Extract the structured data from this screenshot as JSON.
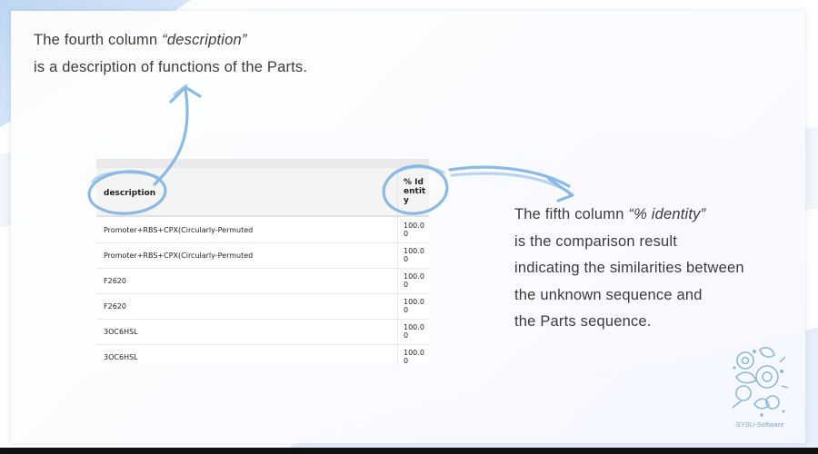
{
  "captions": {
    "top_line1_prefix": "The fourth column ",
    "top_line1_term": "“description”",
    "top_line2": "is a description of functions of the Parts.",
    "right_line1_prefix": "The fifth column ",
    "right_line1_term": "“% identity”",
    "right_line2": "is the comparison result",
    "right_line3": "indicating the similarities between",
    "right_line4": "the unknown sequence and",
    "right_line5": "the Parts sequence."
  },
  "table": {
    "headers": {
      "description": "description",
      "identity": "% Identity"
    },
    "rows": [
      {
        "description": "Promoter+RBS+CPX(Circularly-Permuted",
        "identity": "100.00"
      },
      {
        "description": "Promoter+RBS+CPX(Circularly-Permuted",
        "identity": "100.00"
      },
      {
        "description": "F2620",
        "identity": "100.00"
      },
      {
        "description": "F2620",
        "identity": "100.00"
      },
      {
        "description": "3OC6HSL",
        "identity": "100.00"
      },
      {
        "description": "3OC6HSL",
        "identity": "100.00"
      }
    ]
  },
  "logo": {
    "text": "SYSU-Software",
    "icon": "gear-leaf-logo-icon"
  },
  "colors": {
    "annotation": "#7fb3e3",
    "background_blue": "#a9c8ee",
    "text": "#3b3b3b"
  }
}
